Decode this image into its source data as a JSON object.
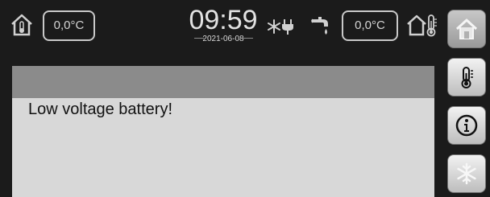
{
  "status_bar": {
    "indoor_temp": "0,0°C",
    "outdoor_temp": "0,0°C",
    "time": "09:59",
    "date": "2021-06-08",
    "icons": [
      "indoor-thermometer-house-icon",
      "defrost-plug-icon",
      "tap-water-icon",
      "outdoor-thermometer-house-icon"
    ]
  },
  "alarm": {
    "message": "Low voltage battery!"
  },
  "sidebar": {
    "buttons": [
      {
        "name": "home-button",
        "icon": "house-icon",
        "active": true
      },
      {
        "name": "temperature-button",
        "icon": "thermometer-icon",
        "active": false
      },
      {
        "name": "info-button",
        "icon": "info-icon",
        "active": false
      },
      {
        "name": "defrost-button",
        "icon": "snowflake-icon",
        "active": false
      }
    ]
  },
  "colors": {
    "background": "#1b1b1b",
    "panel": "#d8d8d8",
    "panel_header": "#8b8b8b",
    "button": "#dcdcdc"
  }
}
